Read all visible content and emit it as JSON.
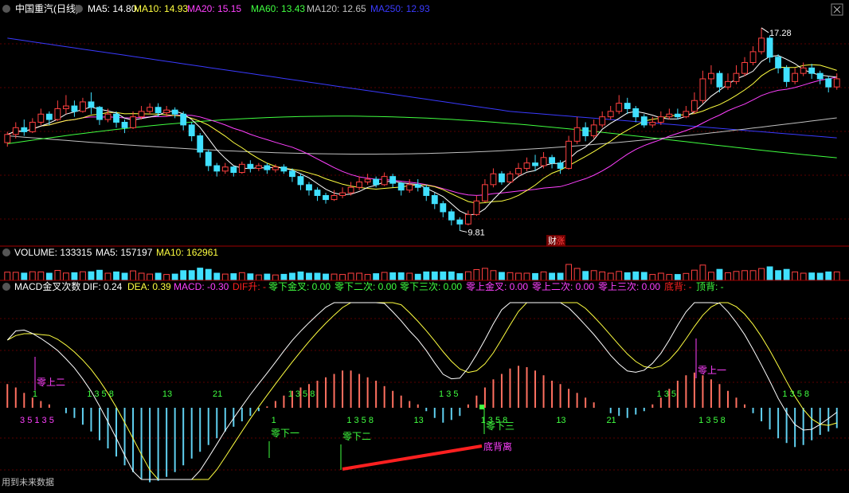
{
  "colors": {
    "bg": "#000000",
    "grid": "#5a0000",
    "divider": "#a00000",
    "up": "#ff4040",
    "down": "#40e0ff",
    "ma5": "#ffffff",
    "ma10": "#ffff40",
    "ma20": "#ff40ff",
    "ma60": "#40ff40",
    "ma120": "#c0c0c0",
    "ma250": "#3a3aff",
    "text": "#ffffff",
    "magenta": "#ff40ff",
    "green": "#40ff40",
    "red": "#ff2020",
    "yellow": "#ffff40"
  },
  "header": {
    "name": "中国重汽(日线)",
    "ma5": "MA5: 14.80",
    "ma10": "MA10: 14.93",
    "ma20": "MA20: 15.15",
    "ma60": "MA60: 13.43",
    "ma120": "MA120: 12.65",
    "ma250": "MA250: 12.93"
  },
  "volume_header": {
    "title": "VOLUME: 133315",
    "ma5": "MA5: 157197",
    "ma10": "MA10: 162961"
  },
  "macd_header": {
    "title": "MACD金叉次数",
    "dif": "DIF: 0.24",
    "dea": "DEA: 0.39",
    "macd": "MACD: -0.30",
    "difup": "DIF升: -",
    "zx_jc": "零下金叉: 0.00",
    "zx_2": "零下二次: 0.00",
    "zx_3": "零下三次: 0.00",
    "zs_jc": "零上金叉: 0.00",
    "zs_2": "零上二次: 0.00",
    "zs_3": "零上三次: 0.00",
    "dibei": "底背: -",
    "dingbei": "顶背: -"
  },
  "footer": "用到未来数据",
  "price_high": "17.28",
  "price_low": "9.81",
  "event_badge": "财",
  "event_badge2": "涨",
  "macd_labels": [
    {
      "text": "零上二",
      "color": "#ff40ff"
    },
    {
      "text": "零下一",
      "color": "#40ff40"
    },
    {
      "text": "零下二",
      "color": "#40ff40"
    },
    {
      "text": "零下三",
      "color": "#40ff40"
    },
    {
      "text": "底背离",
      "color": "#ff40ff"
    },
    {
      "text": "零上一",
      "color": "#ff40ff"
    }
  ],
  "chart_data": {
    "type": "candlestick",
    "price_range": [
      9.5,
      17.6
    ],
    "candles": [
      [
        13.05,
        13.35,
        12.9,
        13.45
      ],
      [
        13.35,
        13.6,
        13.2,
        13.8
      ],
      [
        13.6,
        13.45,
        13.3,
        13.9
      ],
      [
        13.45,
        13.8,
        13.4,
        13.95
      ],
      [
        13.8,
        14.1,
        13.7,
        14.3
      ],
      [
        14.1,
        13.9,
        13.7,
        14.2
      ],
      [
        13.9,
        14.3,
        13.85,
        14.6
      ],
      [
        14.3,
        14.4,
        14.1,
        14.8
      ],
      [
        14.4,
        14.2,
        14.0,
        14.6
      ],
      [
        14.2,
        14.55,
        14.15,
        14.7
      ],
      [
        14.55,
        14.35,
        14.1,
        14.9
      ],
      [
        14.35,
        13.9,
        13.7,
        14.4
      ],
      [
        13.9,
        14.1,
        13.8,
        14.3
      ],
      [
        14.1,
        13.8,
        13.6,
        14.2
      ],
      [
        13.8,
        13.6,
        13.4,
        13.9
      ],
      [
        13.6,
        14.0,
        13.55,
        14.2
      ],
      [
        14.0,
        14.2,
        13.9,
        14.4
      ],
      [
        14.2,
        14.35,
        14.1,
        14.5
      ],
      [
        14.35,
        14.15,
        14.0,
        14.5
      ],
      [
        14.15,
        14.25,
        14.0,
        14.4
      ],
      [
        14.25,
        14.1,
        13.95,
        14.35
      ],
      [
        14.1,
        13.7,
        13.5,
        14.2
      ],
      [
        13.7,
        13.3,
        13.1,
        13.8
      ],
      [
        13.3,
        12.7,
        12.5,
        13.4
      ],
      [
        12.7,
        12.2,
        12.0,
        12.8
      ],
      [
        12.2,
        12.0,
        11.8,
        12.3
      ],
      [
        12.0,
        12.15,
        11.9,
        12.3
      ],
      [
        12.15,
        11.95,
        11.8,
        12.2
      ],
      [
        11.95,
        12.25,
        11.9,
        12.35
      ],
      [
        12.25,
        12.1,
        11.95,
        12.4
      ],
      [
        12.1,
        12.2,
        12.0,
        12.3
      ],
      [
        12.2,
        12.05,
        11.9,
        12.3
      ],
      [
        12.05,
        12.15,
        11.95,
        12.25
      ],
      [
        12.15,
        12.0,
        11.9,
        12.25
      ],
      [
        12.0,
        11.8,
        11.6,
        12.1
      ],
      [
        11.8,
        11.5,
        11.3,
        11.9
      ],
      [
        11.5,
        11.3,
        11.1,
        11.6
      ],
      [
        11.3,
        11.1,
        10.9,
        11.4
      ],
      [
        11.1,
        10.95,
        10.8,
        11.2
      ],
      [
        10.95,
        11.1,
        10.9,
        11.3
      ],
      [
        11.1,
        11.2,
        11.0,
        11.4
      ],
      [
        11.2,
        11.4,
        11.1,
        11.6
      ],
      [
        11.4,
        11.6,
        11.3,
        11.8
      ],
      [
        11.6,
        11.7,
        11.5,
        11.9
      ],
      [
        11.7,
        11.5,
        11.4,
        11.8
      ],
      [
        11.5,
        11.8,
        11.45,
        11.95
      ],
      [
        11.8,
        11.55,
        11.4,
        11.9
      ],
      [
        11.55,
        11.3,
        11.1,
        11.6
      ],
      [
        11.3,
        11.5,
        11.2,
        11.7
      ],
      [
        11.5,
        11.4,
        11.25,
        11.7
      ],
      [
        11.4,
        11.1,
        10.9,
        11.5
      ],
      [
        11.1,
        10.8,
        10.6,
        11.2
      ],
      [
        10.8,
        10.5,
        10.3,
        10.9
      ],
      [
        10.5,
        10.2,
        10.0,
        10.6
      ],
      [
        10.2,
        10.05,
        9.81,
        10.3
      ],
      [
        10.05,
        10.4,
        10.0,
        10.55
      ],
      [
        10.4,
        10.9,
        10.35,
        11.1
      ],
      [
        10.9,
        11.5,
        10.85,
        11.7
      ],
      [
        11.5,
        11.9,
        11.4,
        12.1
      ],
      [
        11.9,
        11.6,
        11.5,
        12.0
      ],
      [
        11.6,
        11.9,
        11.55,
        12.0
      ],
      [
        11.9,
        12.1,
        11.8,
        12.3
      ],
      [
        12.1,
        12.3,
        12.0,
        12.5
      ],
      [
        12.3,
        12.2,
        12.0,
        12.6
      ],
      [
        12.2,
        12.5,
        12.1,
        12.7
      ],
      [
        12.5,
        12.3,
        12.1,
        12.6
      ],
      [
        12.3,
        12.1,
        11.9,
        12.4
      ],
      [
        12.1,
        13.1,
        12.05,
        13.3
      ],
      [
        13.1,
        13.6,
        13.0,
        14.0
      ],
      [
        13.6,
        13.3,
        13.1,
        13.8
      ],
      [
        13.3,
        13.7,
        13.2,
        13.9
      ],
      [
        13.7,
        14.0,
        13.6,
        14.2
      ],
      [
        14.0,
        14.2,
        13.9,
        14.4
      ],
      [
        14.2,
        14.5,
        14.1,
        14.8
      ],
      [
        14.5,
        14.3,
        14.1,
        14.7
      ],
      [
        14.3,
        14.0,
        13.8,
        14.4
      ],
      [
        14.0,
        13.7,
        13.6,
        14.1
      ],
      [
        13.7,
        13.8,
        13.6,
        14.0
      ],
      [
        13.8,
        14.0,
        13.7,
        14.2
      ],
      [
        14.0,
        14.1,
        13.9,
        14.3
      ],
      [
        14.1,
        14.0,
        13.9,
        14.3
      ],
      [
        14.0,
        14.2,
        13.95,
        14.4
      ],
      [
        14.2,
        14.6,
        14.1,
        14.9
      ],
      [
        14.6,
        15.4,
        14.5,
        15.7
      ],
      [
        15.4,
        15.6,
        15.2,
        15.9
      ],
      [
        15.6,
        15.1,
        14.9,
        15.7
      ],
      [
        15.1,
        15.3,
        15.0,
        15.6
      ],
      [
        15.3,
        15.6,
        15.2,
        15.9
      ],
      [
        15.6,
        16.0,
        15.5,
        16.2
      ],
      [
        16.0,
        16.4,
        15.9,
        16.6
      ],
      [
        16.4,
        16.9,
        16.3,
        17.28
      ],
      [
        16.9,
        16.2,
        16.0,
        17.0
      ],
      [
        16.2,
        15.8,
        15.6,
        16.3
      ],
      [
        15.8,
        15.3,
        15.1,
        15.9
      ],
      [
        15.3,
        15.6,
        15.2,
        15.8
      ],
      [
        15.6,
        15.8,
        15.5,
        16.0
      ],
      [
        15.8,
        15.6,
        15.4,
        15.95
      ],
      [
        15.6,
        15.4,
        15.2,
        15.7
      ],
      [
        15.4,
        15.1,
        14.9,
        15.5
      ],
      [
        15.1,
        15.4,
        15.0,
        15.6
      ]
    ],
    "macd_bars": [
      0.35,
      0.3,
      0.22,
      0.15,
      0.1,
      0.05,
      0.0,
      -0.08,
      -0.15,
      -0.25,
      -0.35,
      -0.48,
      -0.6,
      -0.72,
      -0.85,
      -0.95,
      -1.05,
      -1.1,
      -1.08,
      -1.02,
      -0.95,
      -0.85,
      -0.75,
      -0.65,
      -0.55,
      -0.45,
      -0.35,
      -0.28,
      -0.2,
      -0.12,
      -0.05,
      0.02,
      0.1,
      0.18,
      0.25,
      0.3,
      0.35,
      0.4,
      0.45,
      0.5,
      0.55,
      0.55,
      0.5,
      0.45,
      0.4,
      0.32,
      0.25,
      0.18,
      0.1,
      0.05,
      -0.05,
      -0.15,
      -0.22,
      -0.18,
      -0.12,
      0.05,
      0.18,
      0.3,
      0.42,
      0.5,
      0.58,
      0.62,
      0.6,
      0.55,
      0.48,
      0.4,
      0.35,
      0.28,
      0.22,
      0.15,
      0.08,
      0.0,
      -0.08,
      -0.12,
      -0.15,
      -0.1,
      -0.05,
      0.05,
      0.15,
      0.28,
      0.4,
      0.48,
      0.52,
      0.48,
      0.42,
      0.35,
      0.25,
      0.15,
      0.05,
      -0.08,
      -0.2,
      -0.32,
      -0.45,
      -0.52,
      -0.58,
      -0.55,
      -0.48,
      -0.4,
      -0.35,
      -0.3
    ],
    "bar_labels": [
      {
        "text": "3 5 1 3 5",
        "color": "#ff40ff",
        "pos": 0.02,
        "side": "low"
      },
      {
        "text": "1",
        "color": "#40ff40",
        "pos": 0.035,
        "side": "high"
      },
      {
        "text": "1 3 5 8",
        "color": "#40ff40",
        "pos": 0.1,
        "side": "high"
      },
      {
        "text": "13",
        "color": "#40ff40",
        "pos": 0.19,
        "side": "high"
      },
      {
        "text": "21",
        "color": "#40ff40",
        "pos": 0.25,
        "side": "high"
      },
      {
        "text": "1 3 5 8",
        "color": "#40ff40",
        "pos": 0.34,
        "side": "high"
      },
      {
        "text": "1",
        "color": "#40ff40",
        "pos": 0.32,
        "side": "low"
      },
      {
        "text": "1 3 5 8",
        "color": "#40ff40",
        "pos": 0.41,
        "side": "low"
      },
      {
        "text": "13",
        "color": "#40ff40",
        "pos": 0.49,
        "side": "low"
      },
      {
        "text": "1 3 5",
        "color": "#40ff40",
        "pos": 0.52,
        "side": "high"
      },
      {
        "text": "1 3 5 8",
        "color": "#40ff40",
        "pos": 0.57,
        "side": "low"
      },
      {
        "text": "13",
        "color": "#40ff40",
        "pos": 0.66,
        "side": "low"
      },
      {
        "text": "21",
        "color": "#40ff40",
        "pos": 0.72,
        "side": "low"
      },
      {
        "text": "1 3 5",
        "color": "#40ff40",
        "pos": 0.78,
        "side": "high"
      },
      {
        "text": "1 3 5 8",
        "color": "#40ff40",
        "pos": 0.83,
        "side": "low"
      },
      {
        "text": "1 3 5 8",
        "color": "#40ff40",
        "pos": 0.93,
        "side": "high"
      }
    ]
  }
}
